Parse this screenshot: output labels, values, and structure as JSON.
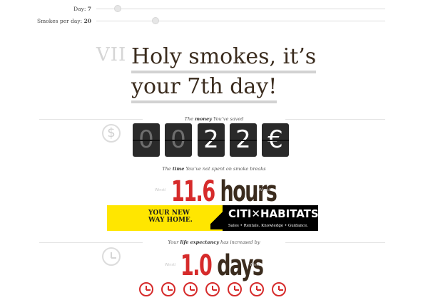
{
  "sliders": {
    "day": {
      "label": "Day:",
      "value": "7"
    },
    "smokes": {
      "label": "Smokes per day:",
      "value": "20"
    }
  },
  "header": {
    "roman": "VII",
    "line1": "Holy smokes, it’s",
    "line2": "your 7th day!"
  },
  "money": {
    "caption_pre": "The",
    "caption_bold": "money",
    "caption_post": "You’ve saved",
    "icon": "dollar-icon",
    "digits": [
      "0",
      "0",
      "2",
      "2",
      "€"
    ]
  },
  "time": {
    "caption_pre": "The",
    "caption_bold": "time",
    "caption_post": "You’ve not spent on smoke breaks",
    "value": "11.6",
    "unit": "hours",
    "tag_left": "Winstl",
    "tag_right": "Winstl"
  },
  "ad": {
    "left_line1": "YOUR NEW",
    "left_line2": "WAY HOME.",
    "brand_left": "CITI",
    "brand_right": "HABITATS",
    "tagline": "Sales • Rentals. Knowledge • Guidance.",
    "colors": {
      "yellow": "#ffe600",
      "black": "#000000"
    }
  },
  "life": {
    "caption_pre": "Your",
    "caption_bold": "life expectancy",
    "caption_post": "has increased by",
    "value": "1.0",
    "unit": "days",
    "tag_left": "Winstl",
    "tag_right": "Winstl",
    "icon": "clock-icon",
    "clock_count": 7
  },
  "colors": {
    "accent_red": "#d62b2b",
    "brown": "#3b2c1e"
  }
}
